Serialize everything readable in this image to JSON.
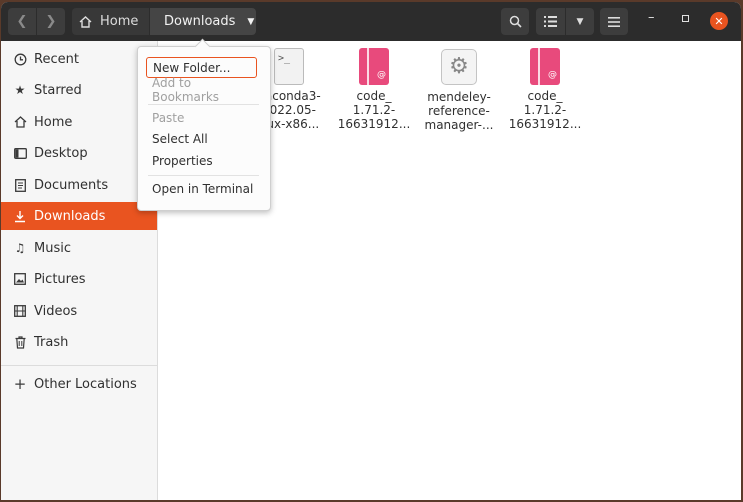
{
  "headerbar": {
    "breadcrumb_home": "Home",
    "breadcrumb_current": "Downloads"
  },
  "sidebar": {
    "items": [
      {
        "label": "Recent",
        "icon": "clock-icon"
      },
      {
        "label": "Starred",
        "icon": "star-icon"
      },
      {
        "label": "Home",
        "icon": "home-icon"
      },
      {
        "label": "Desktop",
        "icon": "desktop-icon"
      },
      {
        "label": "Documents",
        "icon": "document-icon"
      },
      {
        "label": "Downloads",
        "icon": "download-icon",
        "active": true
      },
      {
        "label": "Music",
        "icon": "music-icon"
      },
      {
        "label": "Pictures",
        "icon": "picture-icon"
      },
      {
        "label": "Videos",
        "icon": "film-icon"
      },
      {
        "label": "Trash",
        "icon": "trash-icon"
      }
    ],
    "other_locations": "Other Locations"
  },
  "files": [
    {
      "name": "naconda3-\n2022.05-\nnux-x86...",
      "type": "script"
    },
    {
      "name": "code_\n1.71.2-\n16631912...",
      "type": "deb"
    },
    {
      "name": "mendeley-\nreference-\nmanager-...",
      "type": "package"
    },
    {
      "name": "code_\n1.71.2-\n16631912...",
      "type": "deb"
    }
  ],
  "context_menu": {
    "new_folder": "New Folder...",
    "add_bookmarks": "Add to Bookmarks",
    "paste": "Paste",
    "select_all": "Select All",
    "properties": "Properties",
    "open_terminal": "Open in Terminal"
  },
  "colors": {
    "accent": "#e95420",
    "deb_icon": "#e84a7c",
    "headerbar": "#2c2c2c"
  }
}
